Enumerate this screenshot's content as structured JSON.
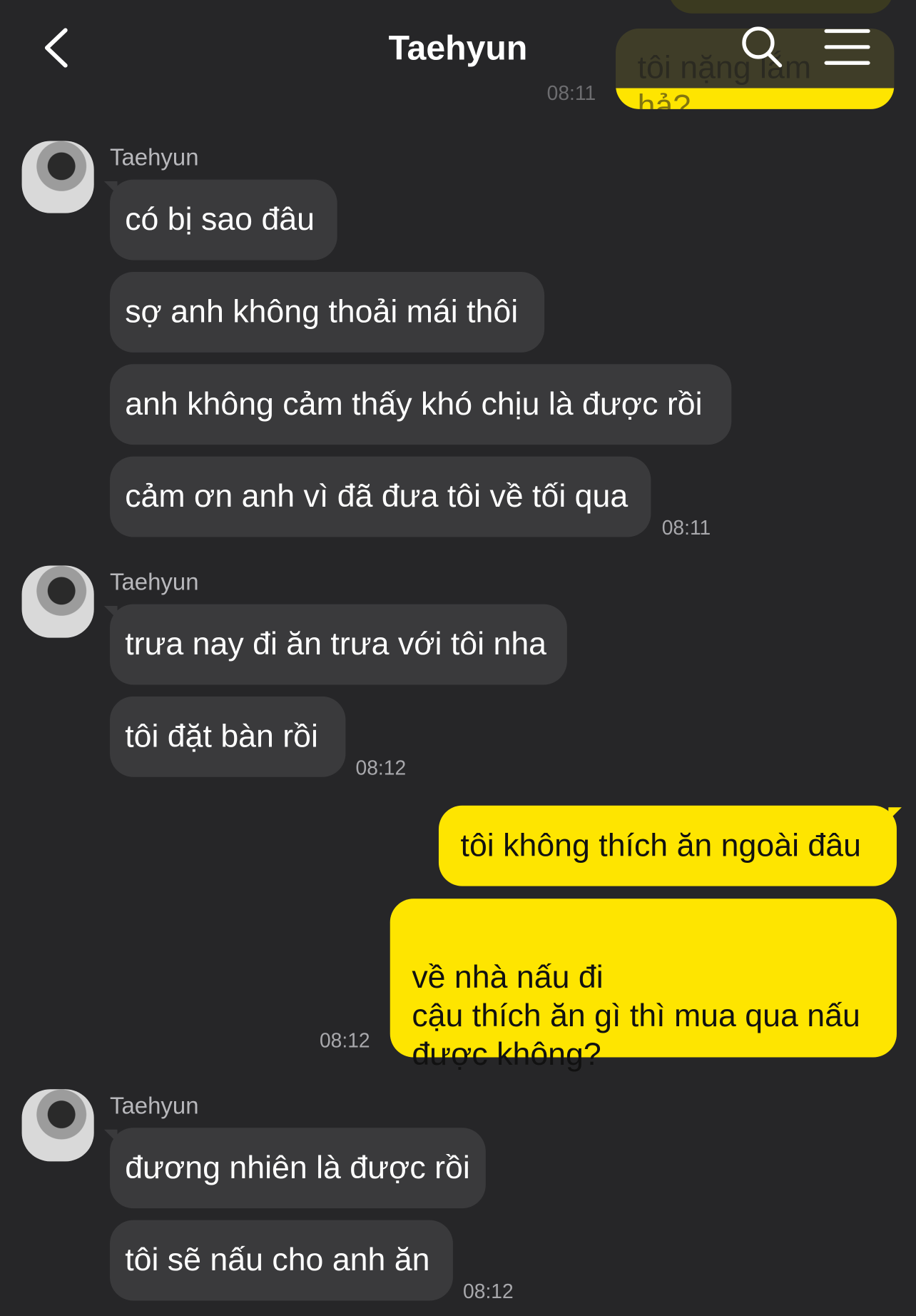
{
  "header": {
    "title": "Taehyun",
    "back_icon": "chevron-left-icon",
    "search_icon": "search-icon",
    "menu_icon": "hamburger-menu-icon"
  },
  "colors": {
    "background": "#262628",
    "incoming_bubble": "#3a3a3c",
    "outgoing_bubble": "#fee500"
  },
  "partial_top": {
    "text": "tôi nặng lắm hả?",
    "time": "08:11"
  },
  "groups": [
    {
      "sender": "Taehyun",
      "messages": [
        "có bị sao đâu",
        "sợ anh không thoải mái thôi",
        "anh không cảm thấy khó chịu là được rồi",
        "cảm ơn anh vì đã đưa tôi về tối qua"
      ],
      "time": "08:11"
    },
    {
      "sender": "Taehyun",
      "messages": [
        "trưa nay đi ăn trưa với tôi nha",
        "tôi đặt bàn rồi"
      ],
      "time": "08:12"
    },
    {
      "sender": "Taehyun",
      "messages": [
        "đương nhiên là được rồi",
        "tôi sẽ nấu cho anh ăn"
      ],
      "time": "08:12"
    }
  ],
  "outgoing": {
    "messages": [
      "tôi không thích ăn ngoài đâu",
      "về nhà nấu đi\ncậu thích ăn gì thì mua qua nấu được không?"
    ],
    "time": "08:12"
  }
}
